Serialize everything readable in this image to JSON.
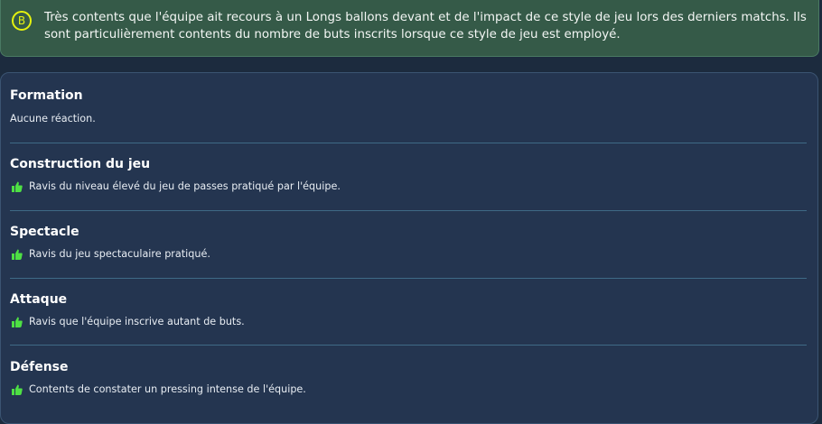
{
  "banner": {
    "grade": "B",
    "text": "Très contents que l'équipe ait recours à un Longs ballons devant et de l'impact de ce style de jeu lors des derniers matchs. Ils sont particulièrement contents du nombre de buts inscrits lorsque ce style de jeu est employé.",
    "grade_color": "#e4f20f"
  },
  "sections": [
    {
      "title": "Formation",
      "text": "Aucune réaction."
    },
    {
      "title": "Construction du jeu",
      "feedback": "Ravis du niveau élevé du jeu de passes pratiqué par l'équipe.",
      "icon": "thumbs-up-icon"
    },
    {
      "title": "Spectacle",
      "feedback": "Ravis du jeu spectaculaire pratiqué.",
      "icon": "thumbs-up-icon"
    },
    {
      "title": "Attaque",
      "feedback": "Ravis que l'équipe inscrive autant de buts.",
      "icon": "thumbs-up-icon"
    },
    {
      "title": "Défense",
      "feedback": "Contents de constater un pressing intense de l'équipe.",
      "icon": "thumbs-up-icon"
    }
  ],
  "colors": {
    "positive": "#4ee044",
    "banner_bg": "#355a48",
    "panel_bg": "#243550"
  }
}
